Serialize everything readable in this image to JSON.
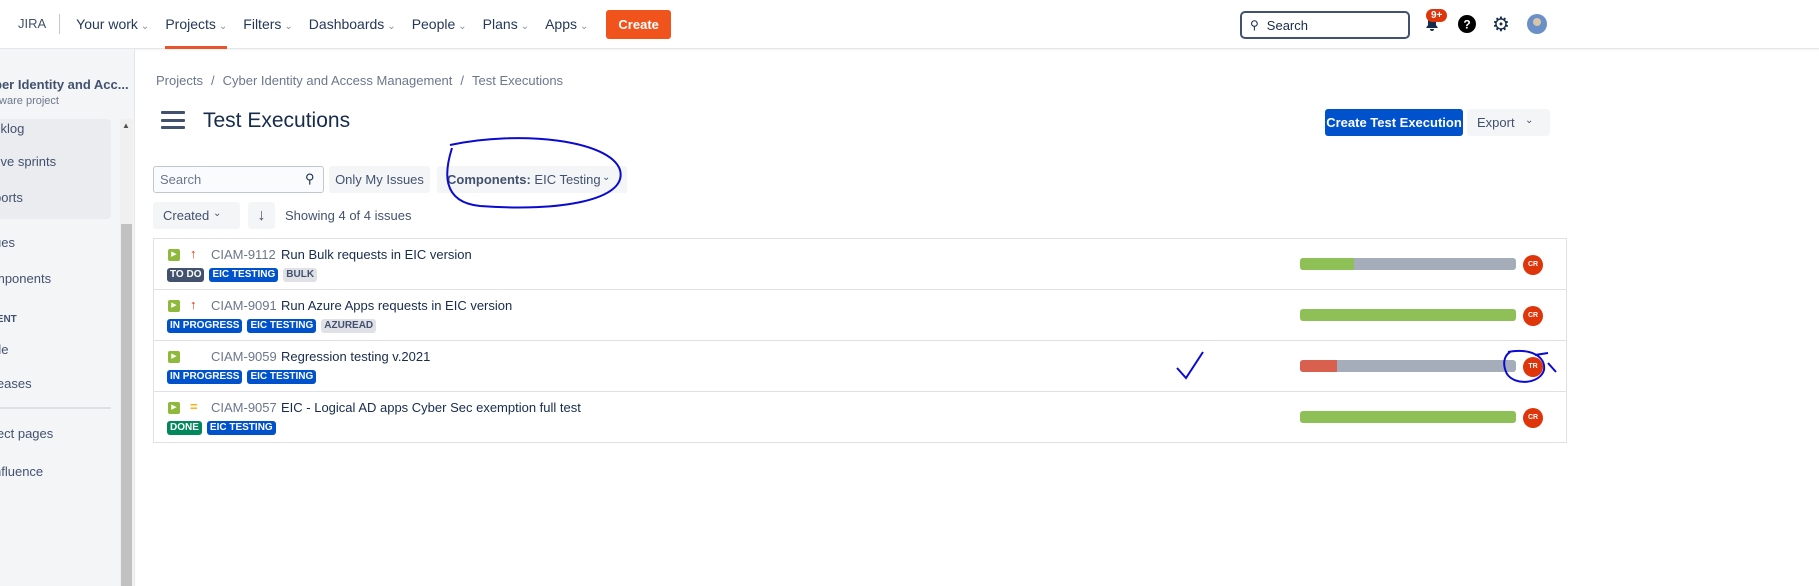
{
  "topnav": {
    "logo": "JIRA",
    "items": [
      {
        "label": "Your work",
        "active": false
      },
      {
        "label": "Projects",
        "active": true
      },
      {
        "label": "Filters",
        "active": false
      },
      {
        "label": "Dashboards",
        "active": false
      },
      {
        "label": "People",
        "active": false
      },
      {
        "label": "Plans",
        "active": false
      },
      {
        "label": "Apps",
        "active": false
      }
    ],
    "create_label": "Create",
    "search_placeholder": "Search",
    "notifications_badge": "9+"
  },
  "sidebar": {
    "project_name": "ber Identity and Acc...",
    "project_type": "tware project",
    "items": [
      "cklog",
      "tive sprints",
      "ports",
      "ues",
      "mponents",
      "de",
      "leases",
      "ject pages",
      "nfluence"
    ],
    "section_heading": "IENT"
  },
  "breadcrumb": [
    "Projects",
    "Cyber Identity and Access Management",
    "Test Executions"
  ],
  "page_title": "Test Executions",
  "actions": {
    "create_test_execution": "Create Test Execution",
    "export": "Export"
  },
  "filters": {
    "search_placeholder": "Search",
    "only_my_issues": "Only My Issues",
    "components_label": "Components:",
    "components_value": "EIC Testing",
    "sort_field": "Created",
    "showing": "Showing 4 of 4 issues"
  },
  "issues": [
    {
      "key": "CIAM-9112",
      "summary": "Run Bulk requests in EIC version",
      "priority": "high",
      "lozenges": [
        {
          "text": "TO DO",
          "color": "#42526e"
        },
        {
          "text": "EIC TESTING",
          "color": "#0052cc"
        },
        {
          "text": "BULK",
          "color": "#dfe1e6"
        }
      ],
      "progress": {
        "pass": 25,
        "fail": 0
      },
      "assignee": "CR"
    },
    {
      "key": "CIAM-9091",
      "summary": "Run Azure Apps requests in EIC version",
      "priority": "high",
      "lozenges": [
        {
          "text": "IN PROGRESS",
          "color": "#0052cc"
        },
        {
          "text": "EIC TESTING",
          "color": "#0052cc"
        },
        {
          "text": "AZUREAD",
          "color": "#dfe1e6"
        }
      ],
      "progress": {
        "pass": 100,
        "fail": 0
      },
      "assignee": "CR"
    },
    {
      "key": "CIAM-9059",
      "summary": "Regression testing v.2021",
      "priority": "none",
      "lozenges": [
        {
          "text": "IN PROGRESS",
          "color": "#0052cc"
        },
        {
          "text": "EIC TESTING",
          "color": "#0052cc"
        }
      ],
      "progress": {
        "pass": 0,
        "fail": 17
      },
      "assignee": "TR"
    },
    {
      "key": "CIAM-9057",
      "summary": "EIC - Logical AD apps Cyber Sec exemption full test",
      "priority": "medium",
      "lozenges": [
        {
          "text": "DONE",
          "color": "#00875a"
        },
        {
          "text": "EIC TESTING",
          "color": "#0052cc"
        }
      ],
      "progress": {
        "pass": 100,
        "fail": 0
      },
      "assignee": "CR"
    }
  ],
  "colors": {
    "pass": "#8fbf57",
    "fail": "#d9604f",
    "todo": "#a5adba",
    "accent": "#0052cc",
    "annotation": "#0a0ad0"
  }
}
